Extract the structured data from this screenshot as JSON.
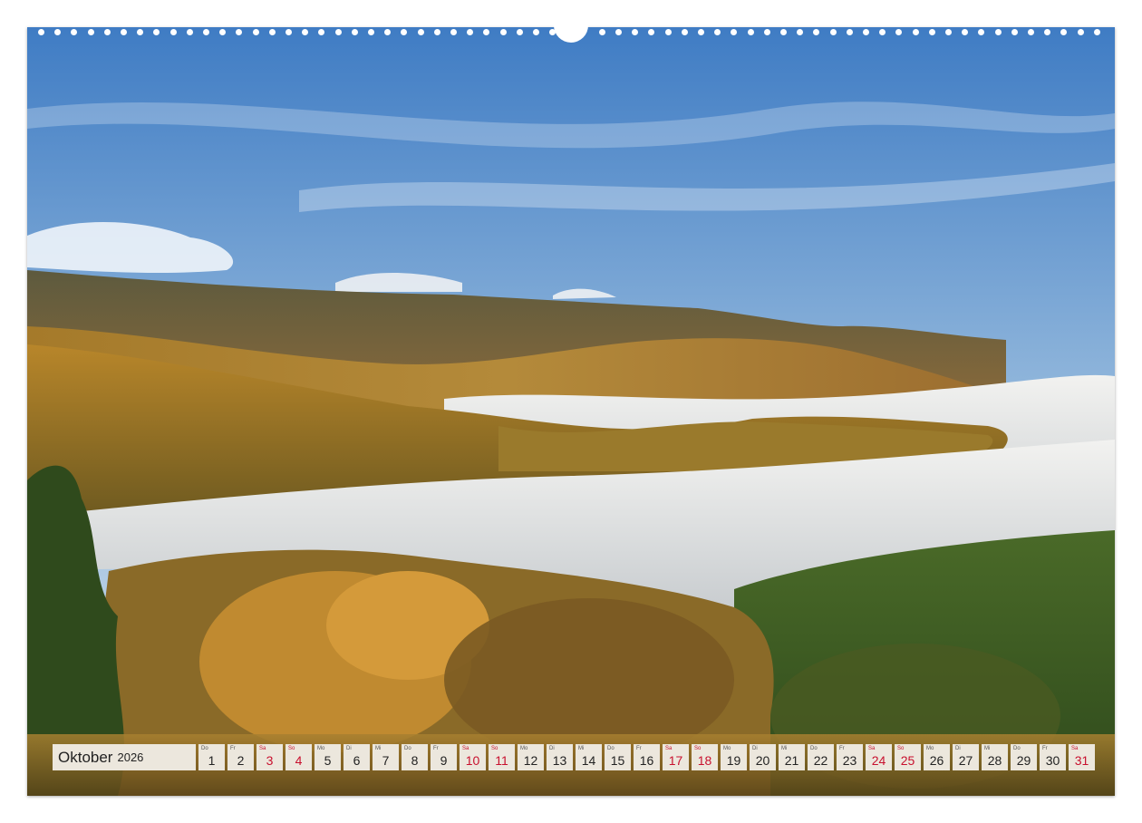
{
  "calendar": {
    "month": "Oktober",
    "year": "2026",
    "days": [
      {
        "wd": "Do",
        "n": "1",
        "we": false
      },
      {
        "wd": "Fr",
        "n": "2",
        "we": false
      },
      {
        "wd": "Sa",
        "n": "3",
        "we": true
      },
      {
        "wd": "So",
        "n": "4",
        "we": true
      },
      {
        "wd": "Mo",
        "n": "5",
        "we": false
      },
      {
        "wd": "Di",
        "n": "6",
        "we": false
      },
      {
        "wd": "Mi",
        "n": "7",
        "we": false
      },
      {
        "wd": "Do",
        "n": "8",
        "we": false
      },
      {
        "wd": "Fr",
        "n": "9",
        "we": false
      },
      {
        "wd": "Sa",
        "n": "10",
        "we": true
      },
      {
        "wd": "So",
        "n": "11",
        "we": true
      },
      {
        "wd": "Mo",
        "n": "12",
        "we": false
      },
      {
        "wd": "Di",
        "n": "13",
        "we": false
      },
      {
        "wd": "Mi",
        "n": "14",
        "we": false
      },
      {
        "wd": "Do",
        "n": "15",
        "we": false
      },
      {
        "wd": "Fr",
        "n": "16",
        "we": false
      },
      {
        "wd": "Sa",
        "n": "17",
        "we": true
      },
      {
        "wd": "So",
        "n": "18",
        "we": true
      },
      {
        "wd": "Mo",
        "n": "19",
        "we": false
      },
      {
        "wd": "Di",
        "n": "20",
        "we": false
      },
      {
        "wd": "Mi",
        "n": "21",
        "we": false
      },
      {
        "wd": "Do",
        "n": "22",
        "we": false
      },
      {
        "wd": "Fr",
        "n": "23",
        "we": false
      },
      {
        "wd": "Sa",
        "n": "24",
        "we": true
      },
      {
        "wd": "So",
        "n": "25",
        "we": true
      },
      {
        "wd": "Mo",
        "n": "26",
        "we": false
      },
      {
        "wd": "Di",
        "n": "27",
        "we": false
      },
      {
        "wd": "Mi",
        "n": "28",
        "we": false
      },
      {
        "wd": "Do",
        "n": "29",
        "we": false
      },
      {
        "wd": "Fr",
        "n": "30",
        "we": false
      },
      {
        "wd": "Sa",
        "n": "31",
        "we": true
      }
    ]
  },
  "colors": {
    "weekend": "#c8102e",
    "cell_bg": "#ece7dd",
    "sky": "#3f7cc4",
    "forest_autumn": "#b98a2c"
  }
}
